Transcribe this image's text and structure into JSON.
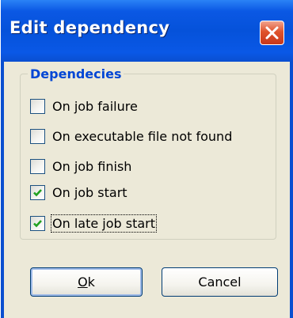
{
  "window": {
    "title": "Edit dependency",
    "close_icon": "close-x-icon"
  },
  "group": {
    "label": "Dependecies"
  },
  "checkboxes": [
    {
      "label": "On job failure",
      "checked": false
    },
    {
      "label": "On executable file not found",
      "checked": false
    },
    {
      "label": "On job finish",
      "checked": false
    },
    {
      "label": "On job start",
      "checked": true
    },
    {
      "label": "On late job start",
      "checked": true,
      "focused": true
    }
  ],
  "buttons": {
    "ok_mnemonic": "O",
    "ok_rest": "k",
    "cancel_label": "Cancel"
  },
  "colors": {
    "titlebar": "#0552da",
    "client": "#ece9d8",
    "group_label": "#0046d5",
    "checkmark": "#21a121",
    "close_button": "#e0532b"
  }
}
